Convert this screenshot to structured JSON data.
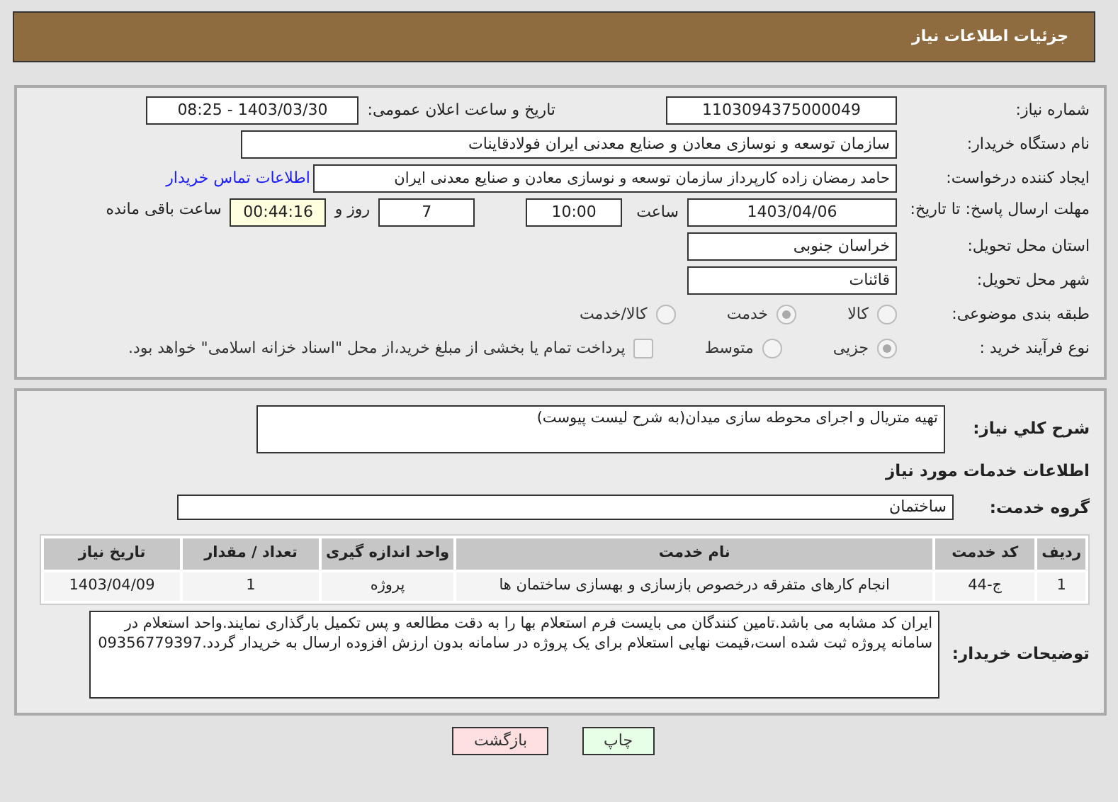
{
  "header": {
    "title": "جزئیات اطلاعات نیاز"
  },
  "need_number": {
    "label": "شماره نیاز:",
    "value": "1103094375000049"
  },
  "announce": {
    "label": "تاریخ و ساعت اعلان عمومی:",
    "value": "1403/03/30 - 08:25"
  },
  "buyer_org": {
    "label": "نام دستگاه خریدار:",
    "value": "سازمان توسعه و نوسازی معادن و صنایع معدنی ایران فولادقاینات"
  },
  "requester": {
    "label": "ایجاد کننده درخواست:",
    "value": "حامد  رمضان زاده  کارپرداز  سازمان توسعه و نوسازی معادن و صنایع معدنی ایران",
    "link": "اطلاعات تماس خریدار"
  },
  "deadline": {
    "label": "مهلت ارسال پاسخ: تا تاریخ:",
    "date": "1403/04/06",
    "time_label": "ساعت",
    "time": "10:00",
    "days": "7",
    "days_label": "روز و",
    "remaining": "00:44:16",
    "remaining_label": "ساعت باقی مانده"
  },
  "province": {
    "label": "استان محل تحویل:",
    "value": "خراسان جنوبی"
  },
  "city": {
    "label": "شهر محل تحویل:",
    "value": "قائنات"
  },
  "category": {
    "label": "طبقه بندی موضوعی:",
    "options": [
      {
        "label": "کالا",
        "selected": false
      },
      {
        "label": "خدمت",
        "selected": true
      },
      {
        "label": "کالا/خدمت",
        "selected": false
      }
    ]
  },
  "process": {
    "label": "نوع فرآیند خرید :",
    "options": [
      {
        "label": "جزیی",
        "selected": true
      },
      {
        "label": "متوسط",
        "selected": false
      }
    ],
    "payment": {
      "label": "پرداخت تمام یا بخشی از مبلغ خرید،از محل \"اسناد خزانه اسلامی\" خواهد بود.",
      "checked": false
    }
  },
  "summary": {
    "label": "شرح کلي نياز:",
    "value": "تهیه متریال و اجرای محوطه سازی میدان(به شرح لیست پیوست)"
  },
  "services_heading": "اطلاعات خدمات مورد نیاز",
  "service_group": {
    "label": "گروه خدمت:",
    "value": "ساختمان"
  },
  "table": {
    "columns": [
      "ردیف",
      "کد خدمت",
      "نام خدمت",
      "واحد اندازه گیری",
      "تعداد / مقدار",
      "تاریخ نیاز"
    ],
    "rows": [
      [
        "1",
        "ج-44",
        "انجام کارهای متفرقه درخصوص بازسازی و بهسازی ساختمان ها",
        "پروژه",
        "1",
        "1403/04/09"
      ]
    ]
  },
  "buyer_notes": {
    "label": "توضیحات خریدار:",
    "value": "ایران کد مشابه می باشد.تامین کنندگان می بایست فرم استعلام بها را به دقت مطالعه و پس تکمیل بارگذاری نمایند.واحد استعلام در سامانه پروژه ثبت شده است،قیمت نهایی استعلام برای یک پروژه در سامانه بدون ارزش افزوده ارسال به خریدار گردد.09356779397"
  },
  "buttons": [
    {
      "label": "چاپ",
      "kind": "print"
    },
    {
      "label": "بازگشت",
      "kind": "back"
    }
  ]
}
